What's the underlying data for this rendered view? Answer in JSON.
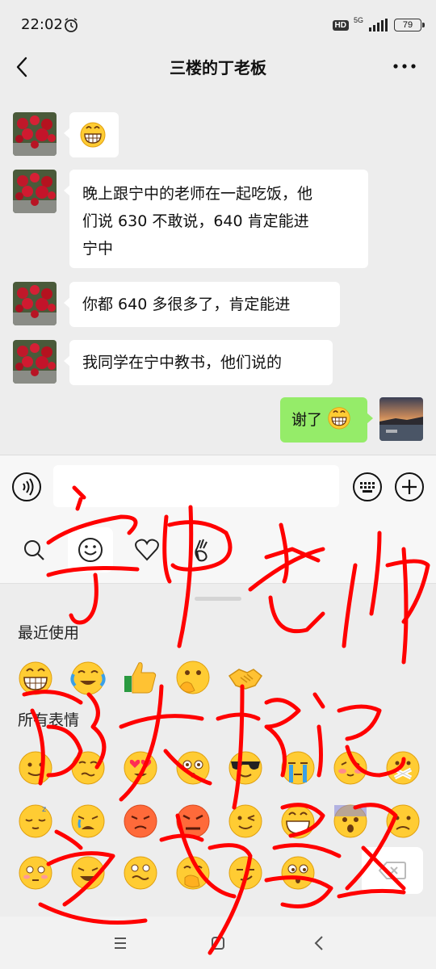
{
  "status_bar": {
    "time": "22:02",
    "network_badge": "HD",
    "network_type": "5G",
    "battery": "79",
    "icons": [
      "alarm-icon",
      "signal-icon",
      "battery-icon"
    ]
  },
  "header": {
    "title": "三楼的丁老板",
    "back_icon": "back-arrow-icon",
    "more_icon": "more-dots-icon"
  },
  "messages": [
    {
      "sender": "other",
      "text": "",
      "emoji": "grin-emoji"
    },
    {
      "sender": "other",
      "lines": [
        "晚上跟宁中的老师在一起吃饭，他",
        "们说 630 不敢说，640 肯定能进",
        "宁中"
      ]
    },
    {
      "sender": "other",
      "text": "你都 640 多很多了，肯定能进"
    },
    {
      "sender": "other",
      "text": "我同学在宁中教书，他们说的"
    },
    {
      "sender": "me",
      "text": "谢了",
      "emoji": "grin-emoji"
    }
  ],
  "input_bar": {
    "voice_icon": "voice-icon",
    "keyboard_icon": "keyboard-icon",
    "plus_icon": "plus-icon"
  },
  "emoji_tabs": [
    "search-icon",
    "smiley-icon",
    "heart-icon",
    "gesture-icon"
  ],
  "emoji_panel": {
    "recent_title": "最近使用",
    "all_title": "所有表情",
    "recent": [
      "grin",
      "crying-laugh",
      "thumbs-up",
      "peek",
      "handshake"
    ],
    "all_rows": [
      [
        "smile",
        "worried",
        "heart-eyes",
        "dazed",
        "cool",
        "crying",
        "shy",
        "mute"
      ],
      [
        "sleepy",
        "sob",
        "angry-red",
        "furious",
        "wink",
        "grin",
        "scared",
        "frown"
      ],
      [
        "embarrassed",
        "tears-laugh",
        "crazy",
        "cover-mouth",
        "smirk",
        "surprised"
      ]
    ],
    "delete_icon": "backspace-icon"
  },
  "system_nav": [
    "menu-icon",
    "home-icon",
    "back-icon"
  ],
  "annotation": {
    "handwriting": "宁中老师 都大概说 这分数",
    "color": "#ff0000"
  }
}
